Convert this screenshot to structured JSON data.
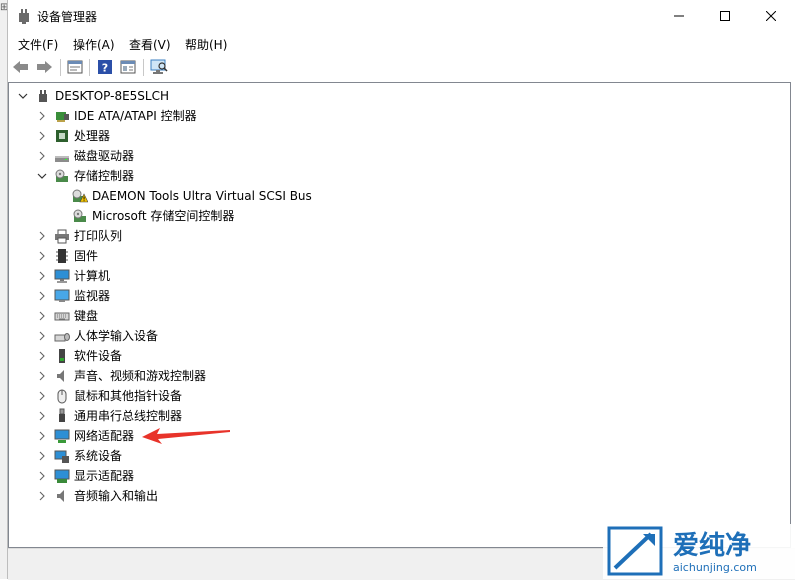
{
  "window": {
    "title": "设备管理器",
    "controls": [
      "minimize",
      "maximize",
      "close"
    ]
  },
  "menu": [
    {
      "label": "文件(F)"
    },
    {
      "label": "操作(A)"
    },
    {
      "label": "查看(V)"
    },
    {
      "label": "帮助(H)"
    }
  ],
  "toolbar": [
    "back-icon",
    "forward-icon",
    "properties-icon",
    "help-icon",
    "view-icon",
    "scan-icon"
  ],
  "tree": {
    "root": {
      "label": "DESKTOP-8E5SLCH",
      "expanded": true,
      "icon": "computer-icon"
    },
    "items": [
      {
        "label": "IDE ATA/ATAPI 控制器",
        "icon": "ide-controller-icon",
        "expanded": false
      },
      {
        "label": "处理器",
        "icon": "processor-icon",
        "expanded": false
      },
      {
        "label": "磁盘驱动器",
        "icon": "disk-drive-icon",
        "expanded": false
      },
      {
        "label": "存储控制器",
        "icon": "storage-controller-icon",
        "expanded": true,
        "children": [
          {
            "label": "DAEMON Tools Ultra Virtual SCSI Bus",
            "icon": "warning-storage-icon"
          },
          {
            "label": "Microsoft 存储空间控制器",
            "icon": "storage-device-icon"
          }
        ]
      },
      {
        "label": "打印队列",
        "icon": "printer-icon",
        "expanded": false
      },
      {
        "label": "固件",
        "icon": "firmware-icon",
        "expanded": false
      },
      {
        "label": "计算机",
        "icon": "computer-monitor-icon",
        "expanded": false
      },
      {
        "label": "监视器",
        "icon": "monitor-icon",
        "expanded": false
      },
      {
        "label": "键盘",
        "icon": "keyboard-icon",
        "expanded": false
      },
      {
        "label": "人体学输入设备",
        "icon": "hid-icon",
        "expanded": false
      },
      {
        "label": "软件设备",
        "icon": "software-device-icon",
        "expanded": false
      },
      {
        "label": "声音、视频和游戏控制器",
        "icon": "speaker-icon",
        "expanded": false
      },
      {
        "label": "鼠标和其他指针设备",
        "icon": "mouse-icon",
        "expanded": false
      },
      {
        "label": "通用串行总线控制器",
        "icon": "usb-icon",
        "expanded": false
      },
      {
        "label": "网络适配器",
        "icon": "network-adapter-icon",
        "expanded": false
      },
      {
        "label": "系统设备",
        "icon": "system-device-icon",
        "expanded": false
      },
      {
        "label": "显示适配器",
        "icon": "display-adapter-icon",
        "expanded": false
      },
      {
        "label": "音频输入和输出",
        "icon": "audio-io-icon",
        "expanded": false
      }
    ]
  },
  "annotation": {
    "type": "red-arrow",
    "target": "网络适配器",
    "color": "#e8332a"
  },
  "watermark": {
    "brand": "爱纯净",
    "url": "aichunjing.com"
  },
  "colors": {
    "accent": "#1e90d6",
    "arrow": "#e8332a"
  }
}
